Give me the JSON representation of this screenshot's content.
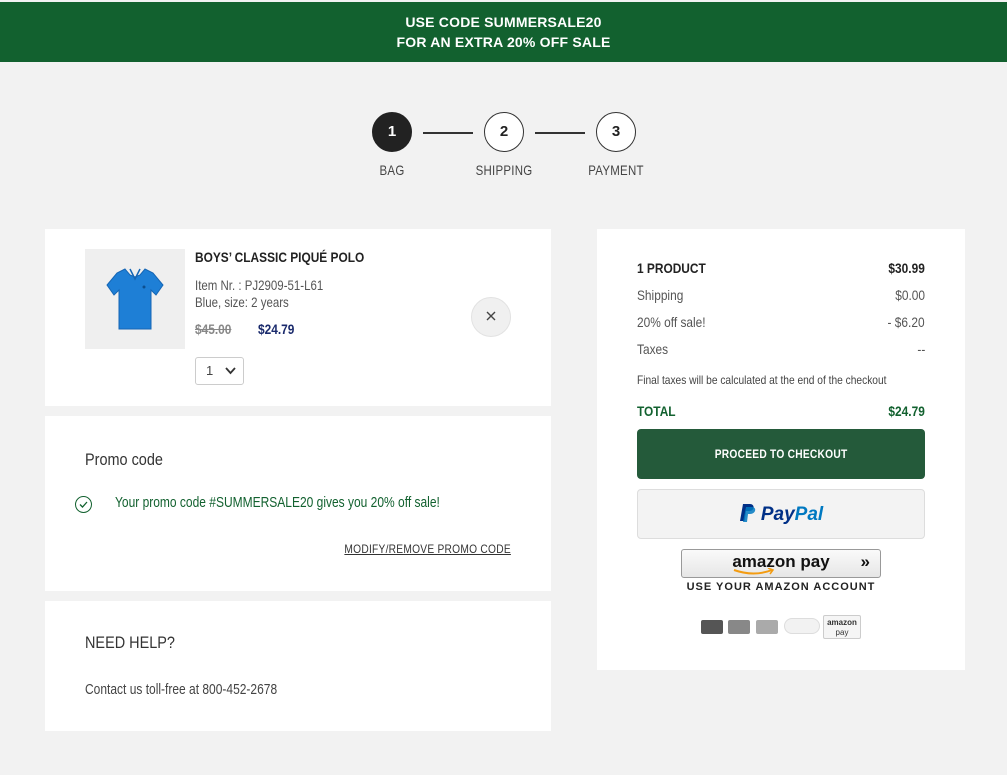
{
  "banner": {
    "line1": "USE CODE SUMMERSALE20",
    "line2": "FOR AN EXTRA 20% OFF SALE",
    "color": "#12612f"
  },
  "steps": [
    {
      "num": "1",
      "label": "BAG",
      "active": true
    },
    {
      "num": "2",
      "label": "SHIPPING",
      "active": false
    },
    {
      "num": "3",
      "label": "PAYMENT",
      "active": false
    }
  ],
  "product": {
    "title": "BOYS’ CLASSIC PIQUÉ POLO",
    "item_nr": "Item Nr. : PJ2909-51-L61",
    "variant": "Blue, size: 2 years",
    "old_price": "$45.00",
    "new_price": "$24.79",
    "quantity": "1",
    "image_icon": "polo-shirt-icon",
    "remove_icon": "close-icon"
  },
  "promo": {
    "title": "Promo code",
    "message": "Your promo code #SUMMERSALE20 gives you 20% off sale!",
    "link": "MODIFY/REMOVE PROMO CODE"
  },
  "help": {
    "title": "NEED HELP?",
    "text": "Contact us toll-free at 800-452-2678"
  },
  "summary": {
    "products_label": "1 PRODUCT",
    "products_value": "$30.99",
    "shipping_label": "Shipping",
    "shipping_value": "$0.00",
    "discount_label": "20% off sale!",
    "discount_value": "- $6.20",
    "taxes_label": "Taxes",
    "taxes_value": "--",
    "note": "Final taxes will be calculated at the end of the checkout",
    "total_label": "TOTAL",
    "total_value": "$24.79",
    "checkout_label": "PROCEED TO CHECKOUT",
    "paypal_pay": "Pay",
    "paypal_pal": "Pal",
    "amazon_label": "amazon pay",
    "amazon_sub": "USE YOUR AMAZON ACCOUNT",
    "amazon_badge_line1": "amazon",
    "amazon_badge_line2": "pay"
  },
  "colors": {
    "accent": "#12612f",
    "checkout": "#245a3a",
    "price": "#1a2a6c"
  }
}
